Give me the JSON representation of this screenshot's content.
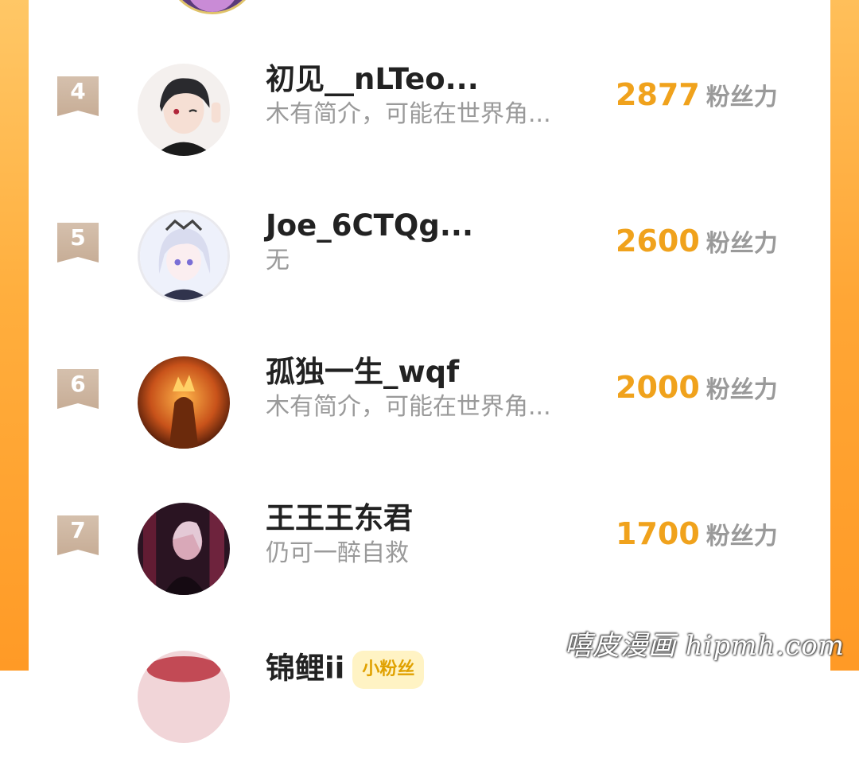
{
  "leaderboard": {
    "unit": "粉丝力",
    "rows": [
      {
        "rank": "4",
        "name": "初见__nLTeo...",
        "bio": "木有简介，可能在世界角...",
        "score": "2877"
      },
      {
        "rank": "5",
        "name": "Joe_6CTQg...",
        "bio": "无",
        "score": "2600"
      },
      {
        "rank": "6",
        "name": "孤独一生_wqf",
        "bio": "木有简介，可能在世界角...",
        "score": "2000"
      },
      {
        "rank": "7",
        "name": "王王王东君",
        "bio": "仍可一醉自救",
        "score": "1700"
      },
      {
        "rank": "",
        "name": "锦鲤ii",
        "badge": "小粉丝",
        "bio": "",
        "score": ""
      }
    ]
  },
  "watermark": "嘻皮漫画 hipmh.com",
  "colors": {
    "accent": "#f0a21c",
    "side": "#ffa635",
    "rank_ribbon": "#cdb7a2"
  }
}
